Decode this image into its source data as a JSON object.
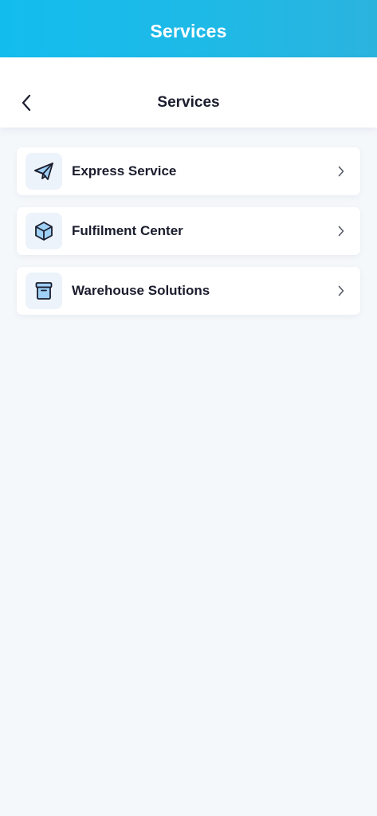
{
  "app_bar": {
    "title": "Services"
  },
  "header": {
    "title": "Services",
    "back_icon": "chevron-left-icon"
  },
  "services": [
    {
      "label": "Express Service",
      "icon": "paper-plane-icon"
    },
    {
      "label": "Fulfilment Center",
      "icon": "cube-icon"
    },
    {
      "label": "Warehouse Solutions",
      "icon": "archive-box-icon"
    }
  ],
  "colors": {
    "app_bar_start": "#12bdee",
    "app_bar_end": "#2bb3de",
    "text_primary": "#1b1d2e",
    "icon_fill": "#9fd0f5",
    "background": "#f5f8fb"
  }
}
